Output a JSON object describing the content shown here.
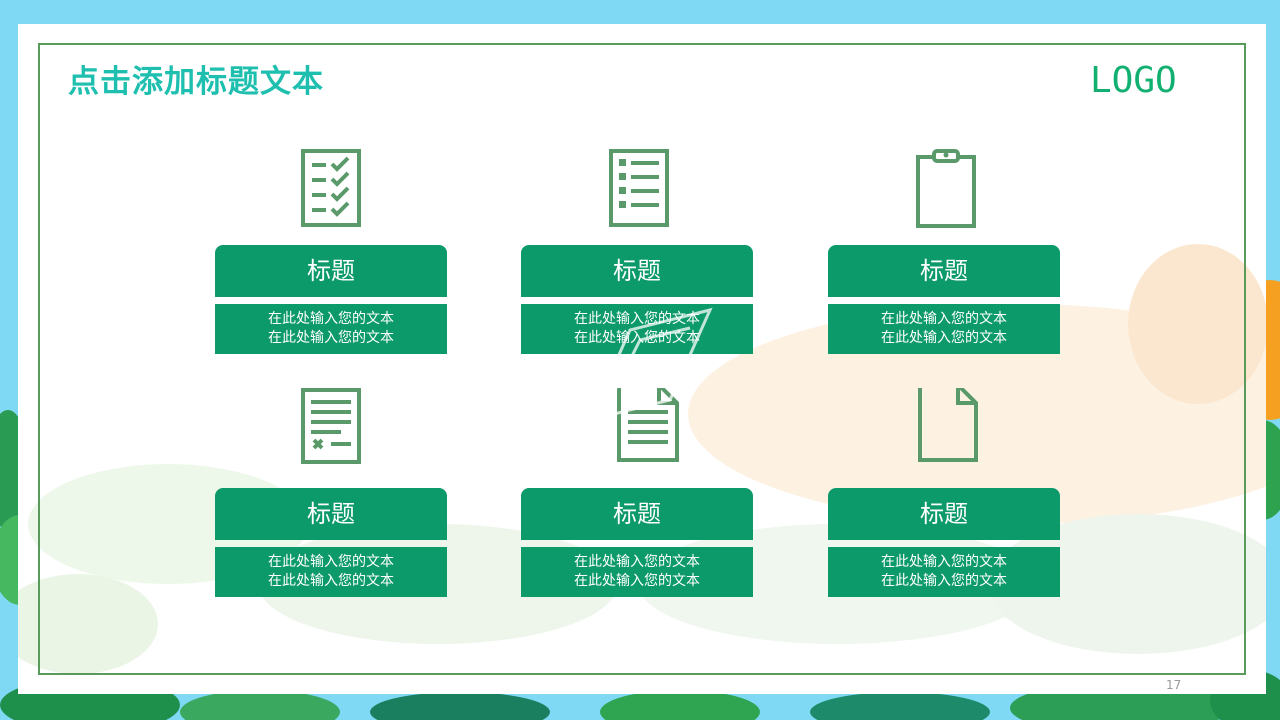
{
  "slide": {
    "title": "点击添加标题文本",
    "logo": "LOGO",
    "page_number": "17"
  },
  "cards": [
    {
      "icon": "checklist-icon",
      "title": "标题",
      "line1": "在此处输入您的文本",
      "line2": "在此处输入您的文本"
    },
    {
      "icon": "bullet-list-icon",
      "title": "标题",
      "line1": "在此处输入您的文本",
      "line2": "在此处输入您的文本"
    },
    {
      "icon": "clipboard-icon",
      "title": "标题",
      "line1": "在此处输入您的文本",
      "line2": "在此处输入您的文本"
    },
    {
      "icon": "form-cancel-icon",
      "title": "标题",
      "line1": "在此处输入您的文本",
      "line2": "在此处输入您的文本"
    },
    {
      "icon": "text-document-icon",
      "title": "标题",
      "line1": "在此处输入您的文本",
      "line2": "在此处输入您的文本"
    },
    {
      "icon": "blank-document-icon",
      "title": "标题",
      "line1": "在此处输入您的文本",
      "line2": "在此处输入您的文本"
    }
  ],
  "colors": {
    "accent": "#0c9a6a",
    "icon": "#5a9a6a",
    "title": "#1fbfb0",
    "logo": "#12b070",
    "frame": "#5a9a5a",
    "background": "#7fd9f5"
  }
}
